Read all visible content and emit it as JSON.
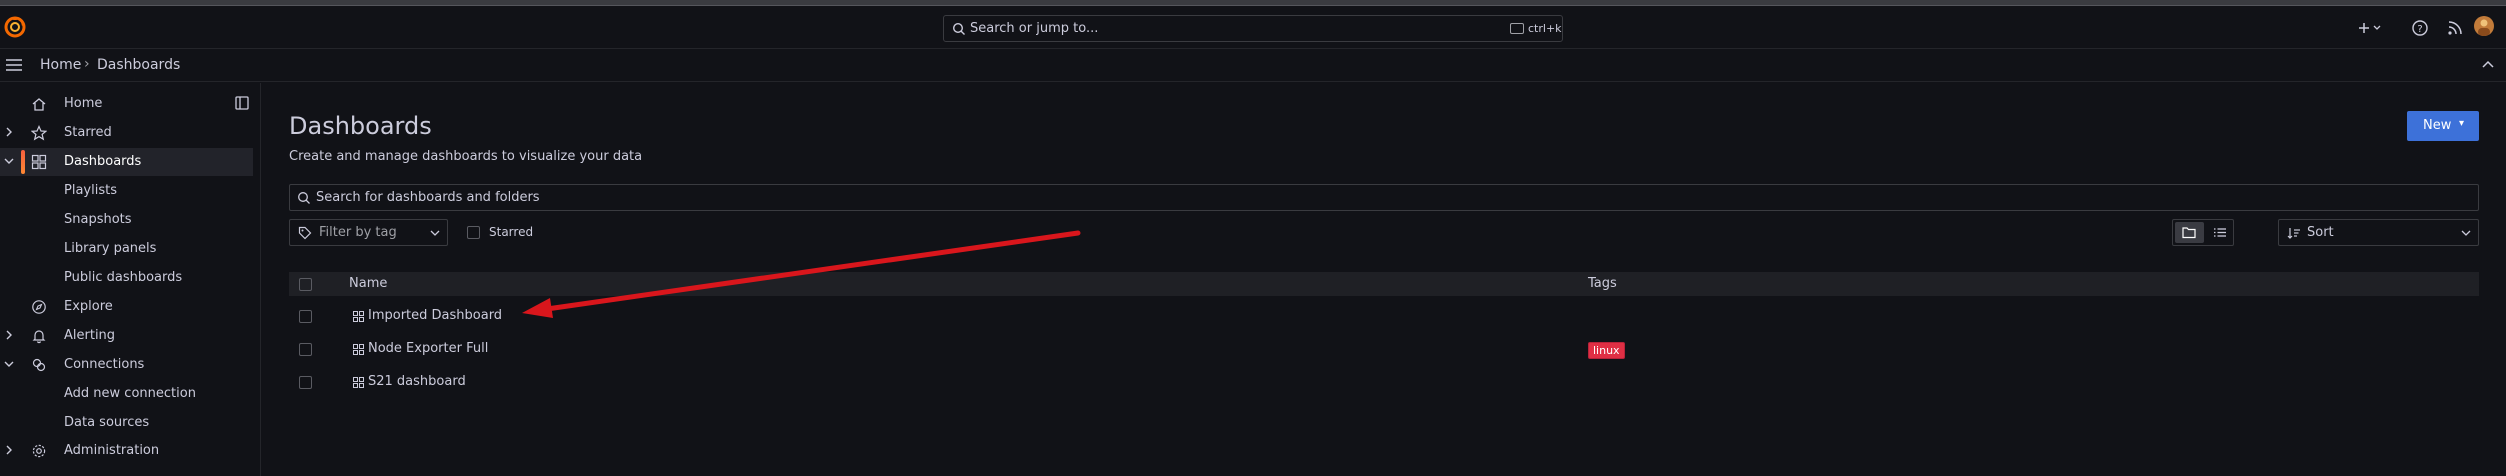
{
  "topbar": {
    "search_placeholder": "Search or jump to...",
    "search_shortcut": "ctrl+k",
    "plus_icon": "plus-icon",
    "help_icon": "help-icon",
    "news_icon": "rss-icon"
  },
  "breadcrumb": {
    "home": "Home",
    "separator": "›",
    "current": "Dashboards"
  },
  "sidebar": {
    "items": [
      {
        "label": "Home",
        "icon": "home-icon",
        "expandable": false
      },
      {
        "label": "Starred",
        "icon": "star-icon",
        "expandable": true
      },
      {
        "label": "Dashboards",
        "icon": "apps-icon",
        "expandable": true,
        "active": true
      },
      {
        "label": "Playlists",
        "sub": true
      },
      {
        "label": "Snapshots",
        "sub": true
      },
      {
        "label": "Library panels",
        "sub": true
      },
      {
        "label": "Public dashboards",
        "sub": true
      },
      {
        "label": "Explore",
        "icon": "compass-icon",
        "expandable": false
      },
      {
        "label": "Alerting",
        "icon": "bell-icon",
        "expandable": true
      },
      {
        "label": "Connections",
        "icon": "link-icon",
        "expandable": true
      },
      {
        "label": "Add new connection",
        "sub": true
      },
      {
        "label": "Data sources",
        "sub": true
      },
      {
        "label": "Administration",
        "icon": "cog-icon",
        "expandable": true
      }
    ]
  },
  "main": {
    "title": "Dashboards",
    "subtitle": "Create and manage dashboards to visualize your data",
    "new_button": "New",
    "search_placeholder": "Search for dashboards and folders",
    "tag_filter_placeholder": "Filter by tag",
    "starred_label": "Starred",
    "sort_label": "Sort",
    "table": {
      "headers": {
        "name": "Name",
        "tags": "Tags"
      },
      "rows": [
        {
          "name": "Imported Dashboard",
          "tags": []
        },
        {
          "name": "Node Exporter Full",
          "tags": [
            "linux"
          ]
        },
        {
          "name": "S21 dashboard",
          "tags": []
        }
      ]
    }
  },
  "colors": {
    "background": "#111217",
    "accent": "#3d71d9",
    "active_bar": "#f55f3e",
    "tag_linux": "#e02f44",
    "annotation_arrow": "#d9161c"
  }
}
